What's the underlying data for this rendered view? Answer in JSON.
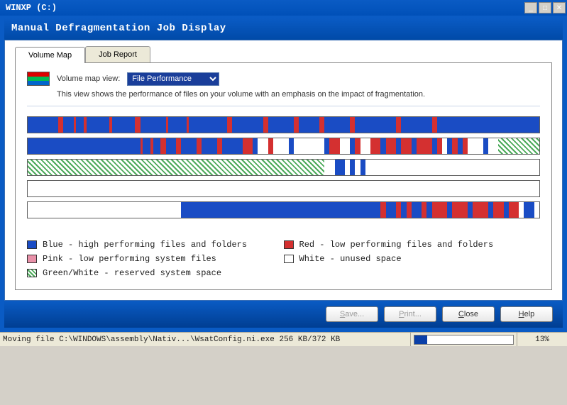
{
  "window": {
    "title": "WINXP (C:)"
  },
  "header": {
    "title": "Manual Defragmentation Job Display"
  },
  "tabs": {
    "active": "Volume Map",
    "items": [
      "Volume Map",
      "Job Report"
    ]
  },
  "view": {
    "label": "Volume map view:",
    "selected": "File Performance",
    "description": "This view shows the performance of files on your volume with an emphasis on the impact of fragmentation."
  },
  "volume_rows": [
    {
      "segments": [
        {
          "c": "blue",
          "s": 0,
          "e": 6
        },
        {
          "c": "red",
          "s": 6,
          "e": 7
        },
        {
          "c": "blue",
          "s": 7,
          "e": 9
        },
        {
          "c": "red",
          "s": 9,
          "e": 9.5
        },
        {
          "c": "blue",
          "s": 9.5,
          "e": 11
        },
        {
          "c": "red",
          "s": 11,
          "e": 11.5
        },
        {
          "c": "blue",
          "s": 11.5,
          "e": 16
        },
        {
          "c": "red",
          "s": 16,
          "e": 16.5
        },
        {
          "c": "blue",
          "s": 16.5,
          "e": 21
        },
        {
          "c": "red",
          "s": 21,
          "e": 22
        },
        {
          "c": "blue",
          "s": 22,
          "e": 27
        },
        {
          "c": "red",
          "s": 27,
          "e": 27.5
        },
        {
          "c": "blue",
          "s": 27.5,
          "e": 31
        },
        {
          "c": "red",
          "s": 31,
          "e": 31.5
        },
        {
          "c": "blue",
          "s": 31.5,
          "e": 39
        },
        {
          "c": "red",
          "s": 39,
          "e": 40
        },
        {
          "c": "blue",
          "s": 40,
          "e": 46
        },
        {
          "c": "red",
          "s": 46,
          "e": 47
        },
        {
          "c": "blue",
          "s": 47,
          "e": 52
        },
        {
          "c": "red",
          "s": 52,
          "e": 53
        },
        {
          "c": "blue",
          "s": 53,
          "e": 57
        },
        {
          "c": "red",
          "s": 57,
          "e": 58
        },
        {
          "c": "blue",
          "s": 58,
          "e": 63
        },
        {
          "c": "red",
          "s": 63,
          "e": 64
        },
        {
          "c": "blue",
          "s": 64,
          "e": 72
        },
        {
          "c": "red",
          "s": 72,
          "e": 73
        },
        {
          "c": "blue",
          "s": 73,
          "e": 79
        },
        {
          "c": "red",
          "s": 79,
          "e": 80
        },
        {
          "c": "blue",
          "s": 80,
          "e": 100
        }
      ]
    },
    {
      "segments": [
        {
          "c": "blue",
          "s": 0,
          "e": 22
        },
        {
          "c": "red",
          "s": 22,
          "e": 22.5
        },
        {
          "c": "blue",
          "s": 22.5,
          "e": 24
        },
        {
          "c": "red",
          "s": 24,
          "e": 24.5
        },
        {
          "c": "blue",
          "s": 24.5,
          "e": 26
        },
        {
          "c": "red",
          "s": 26,
          "e": 27
        },
        {
          "c": "blue",
          "s": 27,
          "e": 29
        },
        {
          "c": "red",
          "s": 29,
          "e": 30
        },
        {
          "c": "blue",
          "s": 30,
          "e": 33
        },
        {
          "c": "red",
          "s": 33,
          "e": 34
        },
        {
          "c": "blue",
          "s": 34,
          "e": 37
        },
        {
          "c": "red",
          "s": 37,
          "e": 38
        },
        {
          "c": "blue",
          "s": 38,
          "e": 42
        },
        {
          "c": "red",
          "s": 42,
          "e": 44
        },
        {
          "c": "blue",
          "s": 44,
          "e": 45
        },
        {
          "c": "white",
          "s": 45,
          "e": 47
        },
        {
          "c": "red",
          "s": 47,
          "e": 48
        },
        {
          "c": "white",
          "s": 48,
          "e": 51
        },
        {
          "c": "blue",
          "s": 51,
          "e": 52
        },
        {
          "c": "white",
          "s": 52,
          "e": 58
        },
        {
          "c": "blue",
          "s": 58,
          "e": 59
        },
        {
          "c": "red",
          "s": 59,
          "e": 61
        },
        {
          "c": "white",
          "s": 61,
          "e": 63
        },
        {
          "c": "blue",
          "s": 63,
          "e": 64
        },
        {
          "c": "red",
          "s": 64,
          "e": 65
        },
        {
          "c": "white",
          "s": 65,
          "e": 67
        },
        {
          "c": "red",
          "s": 67,
          "e": 69
        },
        {
          "c": "blue",
          "s": 69,
          "e": 70
        },
        {
          "c": "red",
          "s": 70,
          "e": 72
        },
        {
          "c": "blue",
          "s": 72,
          "e": 73
        },
        {
          "c": "red",
          "s": 73,
          "e": 75
        },
        {
          "c": "blue",
          "s": 75,
          "e": 76
        },
        {
          "c": "red",
          "s": 76,
          "e": 79
        },
        {
          "c": "blue",
          "s": 79,
          "e": 80
        },
        {
          "c": "red",
          "s": 80,
          "e": 81
        },
        {
          "c": "white",
          "s": 81,
          "e": 82
        },
        {
          "c": "blue",
          "s": 82,
          "e": 83
        },
        {
          "c": "red",
          "s": 83,
          "e": 84
        },
        {
          "c": "blue",
          "s": 84,
          "e": 85
        },
        {
          "c": "red",
          "s": 85,
          "e": 86
        },
        {
          "c": "white",
          "s": 86,
          "e": 89
        },
        {
          "c": "blue",
          "s": 89,
          "e": 90
        },
        {
          "c": "white",
          "s": 90,
          "e": 92
        },
        {
          "c": "green",
          "s": 92,
          "e": 100
        }
      ]
    },
    {
      "segments": [
        {
          "c": "green",
          "s": 0,
          "e": 58
        },
        {
          "c": "white",
          "s": 58,
          "e": 60
        },
        {
          "c": "blue",
          "s": 60,
          "e": 62
        },
        {
          "c": "white",
          "s": 62,
          "e": 63
        },
        {
          "c": "blue",
          "s": 63,
          "e": 64
        },
        {
          "c": "white",
          "s": 64,
          "e": 65
        },
        {
          "c": "blue",
          "s": 65,
          "e": 66
        },
        {
          "c": "white",
          "s": 66,
          "e": 100
        }
      ]
    },
    {
      "segments": [
        {
          "c": "white",
          "s": 0,
          "e": 100
        }
      ]
    },
    {
      "segments": [
        {
          "c": "white",
          "s": 0,
          "e": 30
        },
        {
          "c": "blue",
          "s": 30,
          "e": 69
        },
        {
          "c": "red",
          "s": 69,
          "e": 70
        },
        {
          "c": "blue",
          "s": 70,
          "e": 72
        },
        {
          "c": "red",
          "s": 72,
          "e": 73
        },
        {
          "c": "blue",
          "s": 73,
          "e": 74
        },
        {
          "c": "red",
          "s": 74,
          "e": 75
        },
        {
          "c": "blue",
          "s": 75,
          "e": 77
        },
        {
          "c": "red",
          "s": 77,
          "e": 78
        },
        {
          "c": "blue",
          "s": 78,
          "e": 79
        },
        {
          "c": "red",
          "s": 79,
          "e": 82
        },
        {
          "c": "blue",
          "s": 82,
          "e": 83
        },
        {
          "c": "red",
          "s": 83,
          "e": 86
        },
        {
          "c": "blue",
          "s": 86,
          "e": 87
        },
        {
          "c": "red",
          "s": 87,
          "e": 90
        },
        {
          "c": "blue",
          "s": 90,
          "e": 91
        },
        {
          "c": "red",
          "s": 91,
          "e": 93
        },
        {
          "c": "blue",
          "s": 93,
          "e": 94
        },
        {
          "c": "red",
          "s": 94,
          "e": 96
        },
        {
          "c": "white",
          "s": 96,
          "e": 97
        },
        {
          "c": "blue",
          "s": 97,
          "e": 99
        },
        {
          "c": "white",
          "s": 99,
          "e": 100
        }
      ]
    }
  ],
  "legend": {
    "col1": [
      {
        "color": "blue",
        "text": "Blue - high performing files and folders"
      },
      {
        "color": "pink",
        "text": "Pink - low performing system files"
      },
      {
        "color": "green",
        "text": "Green/White - reserved system space"
      }
    ],
    "col2": [
      {
        "color": "red",
        "text": "Red - low performing files and folders"
      },
      {
        "color": "white",
        "text": "White - unused space"
      }
    ]
  },
  "buttons": {
    "save": "Save...",
    "print": "Print...",
    "close": "Close",
    "help": "Help"
  },
  "status": {
    "text": "Moving file C:\\WINDOWS\\assembly\\Nativ...\\WsatConfig.ni.exe  256 KB/372 KB",
    "progress_pct": 13,
    "pct_text": "13%"
  }
}
